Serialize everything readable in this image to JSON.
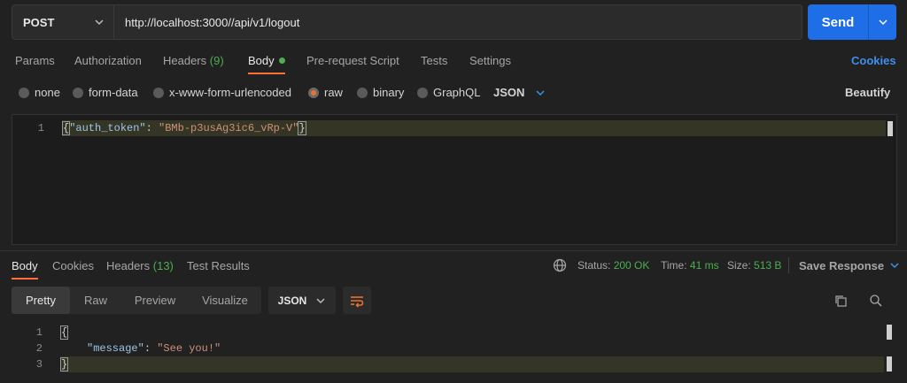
{
  "request": {
    "method": "POST",
    "url": "http://localhost:3000//api/v1/logout",
    "send_label": "Send"
  },
  "request_tabs": {
    "params": "Params",
    "authorization": "Authorization",
    "headers": "Headers",
    "headers_count": "(9)",
    "body": "Body",
    "pre_request": "Pre-request Script",
    "tests": "Tests",
    "settings": "Settings",
    "cookies": "Cookies"
  },
  "body_types": {
    "none": "none",
    "form_data": "form-data",
    "urlencoded": "x-www-form-urlencoded",
    "raw": "raw",
    "binary": "binary",
    "graphql": "GraphQL",
    "language": "JSON",
    "beautify": "Beautify",
    "selected": "raw"
  },
  "request_editor": {
    "line1_no": "1",
    "key": "\"auth_token\"",
    "colon": ": ",
    "value": "\"BMb-p3usAg3ic6_vRp-V\""
  },
  "response_tabs": {
    "body": "Body",
    "cookies": "Cookies",
    "headers": "Headers",
    "headers_count": "(13)",
    "test_results": "Test Results"
  },
  "response_status": {
    "status_label": "Status:",
    "status_value": "200 OK",
    "time_label": "Time:",
    "time_value": "41 ms",
    "size_label": "Size:",
    "size_value": "513 B",
    "save_response": "Save Response"
  },
  "response_view": {
    "pretty": "Pretty",
    "raw": "Raw",
    "preview": "Preview",
    "visualize": "Visualize",
    "format": "JSON"
  },
  "response_editor": {
    "line1_no": "1",
    "line2_no": "2",
    "line3_no": "3",
    "open_brace": "{",
    "key": "\"message\"",
    "colon": ": ",
    "value": "\"See you!\"",
    "close_brace": "}"
  },
  "colors": {
    "accent": "#ff6c37",
    "send_blue": "#1e6ee8",
    "status_green": "#4caf50",
    "link_blue": "#3d8ff0"
  }
}
